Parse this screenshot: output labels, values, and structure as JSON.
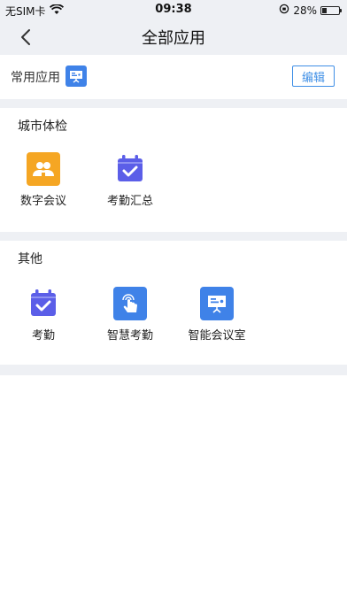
{
  "status": {
    "carrier": "无SIM卡",
    "time": "09:38",
    "battery": "28%",
    "battery_level": 0.28
  },
  "nav": {
    "title": "全部应用"
  },
  "common": {
    "label": "常用应用",
    "edit": "编辑"
  },
  "sections": [
    {
      "title": "城市体检",
      "apps": [
        {
          "label": "数字会议",
          "icon": "meeting-people-icon",
          "color": "#f5a623"
        },
        {
          "label": "考勤汇总",
          "icon": "calendar-check-icon",
          "color": "#5b5ee8"
        }
      ]
    },
    {
      "title": "其他",
      "apps": [
        {
          "label": "考勤",
          "icon": "calendar-check-icon",
          "color": "#5b5ee8"
        },
        {
          "label": "智慧考勤",
          "icon": "touch-hand-icon",
          "color": "#3f82e8"
        },
        {
          "label": "智能会议室",
          "icon": "presentation-board-icon",
          "color": "#3f82e8"
        }
      ]
    }
  ]
}
